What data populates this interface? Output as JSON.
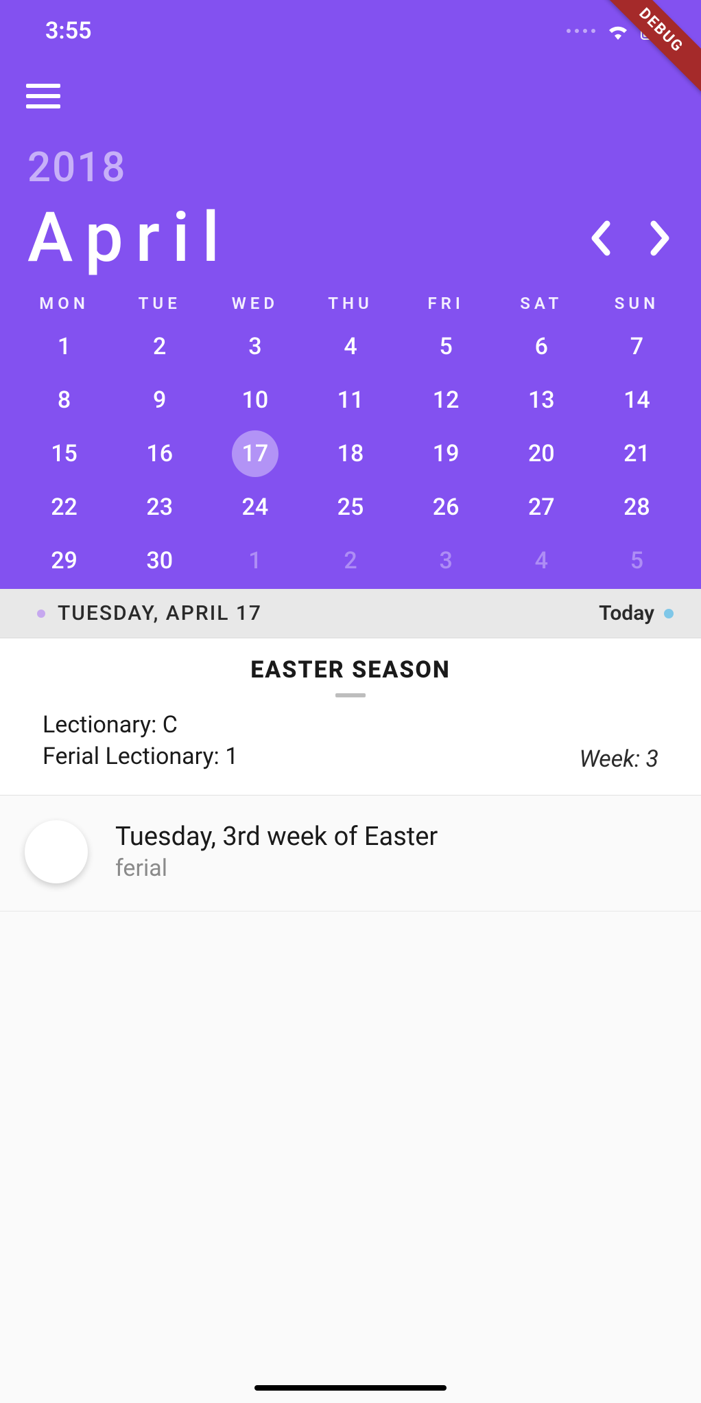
{
  "status": {
    "time": "3:55"
  },
  "debug_label": "DEBUG",
  "calendar": {
    "year": "2018",
    "month": "April",
    "weekdays": [
      "MON",
      "TUE",
      "WED",
      "THU",
      "FRI",
      "SAT",
      "SUN"
    ],
    "selected_day": 17,
    "grid": [
      {
        "n": 1,
        "out": false
      },
      {
        "n": 2,
        "out": false
      },
      {
        "n": 3,
        "out": false
      },
      {
        "n": 4,
        "out": false
      },
      {
        "n": 5,
        "out": false
      },
      {
        "n": 6,
        "out": false
      },
      {
        "n": 7,
        "out": false
      },
      {
        "n": 8,
        "out": false
      },
      {
        "n": 9,
        "out": false
      },
      {
        "n": 10,
        "out": false
      },
      {
        "n": 11,
        "out": false
      },
      {
        "n": 12,
        "out": false
      },
      {
        "n": 13,
        "out": false
      },
      {
        "n": 14,
        "out": false
      },
      {
        "n": 15,
        "out": false
      },
      {
        "n": 16,
        "out": false
      },
      {
        "n": 17,
        "out": false,
        "selected": true
      },
      {
        "n": 18,
        "out": false
      },
      {
        "n": 19,
        "out": false
      },
      {
        "n": 20,
        "out": false
      },
      {
        "n": 21,
        "out": false
      },
      {
        "n": 22,
        "out": false
      },
      {
        "n": 23,
        "out": false
      },
      {
        "n": 24,
        "out": false
      },
      {
        "n": 25,
        "out": false
      },
      {
        "n": 26,
        "out": false
      },
      {
        "n": 27,
        "out": false
      },
      {
        "n": 28,
        "out": false
      },
      {
        "n": 29,
        "out": false
      },
      {
        "n": 30,
        "out": false
      },
      {
        "n": 1,
        "out": true
      },
      {
        "n": 2,
        "out": true
      },
      {
        "n": 3,
        "out": true
      },
      {
        "n": 4,
        "out": true
      },
      {
        "n": 5,
        "out": true
      }
    ]
  },
  "midbar": {
    "date_label": "TUESDAY, APRIL 17",
    "today_label": "Today"
  },
  "season": {
    "title": "EASTER SEASON",
    "lectionary_label": "Lectionary:",
    "lectionary_value": "C",
    "ferial_label": "Ferial Lectionary:",
    "ferial_value": "1",
    "week_label": "Week:",
    "week_value": "3"
  },
  "feast": {
    "title": "Tuesday, 3rd week of Easter",
    "rank": "ferial"
  }
}
